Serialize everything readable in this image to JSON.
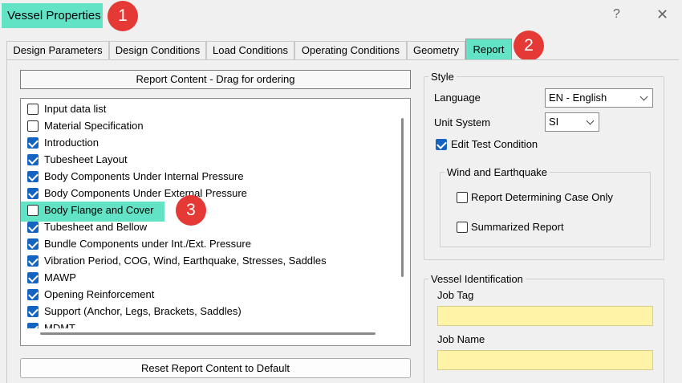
{
  "window": {
    "title": "Vessel Properties",
    "help": "?",
    "close": "✕"
  },
  "badges": [
    "1",
    "2",
    "3"
  ],
  "tabs": [
    {
      "label": "Design Parameters"
    },
    {
      "label": "Design Conditions"
    },
    {
      "label": "Load Conditions"
    },
    {
      "label": "Operating Conditions"
    },
    {
      "label": "Geometry"
    },
    {
      "label": "Report",
      "active": true
    }
  ],
  "report_content": {
    "header": "Report Content - Drag for ordering",
    "items": [
      {
        "label": "Input data list",
        "checked": false
      },
      {
        "label": "Material Specification",
        "checked": false
      },
      {
        "label": "Introduction",
        "checked": true
      },
      {
        "label": "Tubesheet Layout",
        "checked": true
      },
      {
        "label": "Body Components Under Internal Pressure",
        "checked": true
      },
      {
        "label": "Body Components Under External Pressure",
        "checked": true
      },
      {
        "label": "Body Flange and Cover",
        "checked": false
      },
      {
        "label": "Tubesheet and Bellow",
        "checked": true
      },
      {
        "label": "Bundle Components under Int./Ext. Pressure",
        "checked": true
      },
      {
        "label": "Vibration Period, COG, Wind, Earthquake, Stresses, Saddles",
        "checked": true
      },
      {
        "label": "MAWP",
        "checked": true
      },
      {
        "label": "Opening Reinforcement",
        "checked": true
      },
      {
        "label": "Support (Anchor, Legs, Brackets, Saddles)",
        "checked": true
      },
      {
        "label": "MDMT",
        "checked": true
      }
    ],
    "reset_button": "Reset Report Content to Default"
  },
  "style": {
    "group_title": "Style",
    "language_label": "Language",
    "language_value": "EN - English",
    "unit_label": "Unit System",
    "unit_value": "SI",
    "edit_test_condition": {
      "label": "Edit Test Condition",
      "checked": true
    },
    "wind_earthquake": {
      "group_title": "Wind and Earthquake",
      "report_determining": {
        "label": "Report Determining Case Only",
        "checked": false
      },
      "summarized": {
        "label": "Summarized Report",
        "checked": false
      }
    }
  },
  "vessel_identification": {
    "group_title": "Vessel Identification",
    "job_tag_label": "Job Tag",
    "job_tag_value": "",
    "job_name_label": "Job Name",
    "job_name_value": ""
  },
  "colors": {
    "highlight": "#63e3c5",
    "badge": "#e53935",
    "checkbox_checked": "#1565c0",
    "input_yellow": "#fff3a6"
  }
}
